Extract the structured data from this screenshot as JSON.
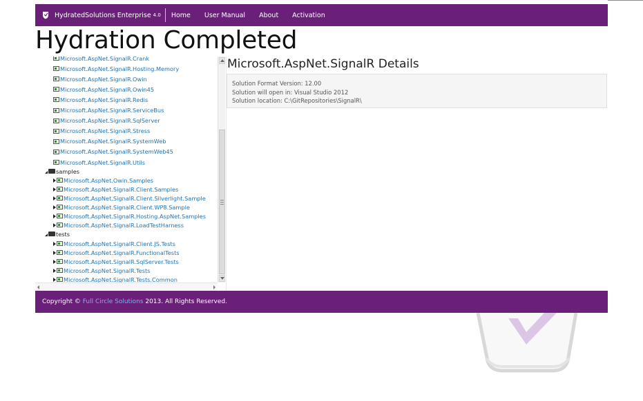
{
  "navbar": {
    "brand": "HydratedSolutions Enterprise",
    "version": "4.0",
    "items": [
      "Home",
      "User Manual",
      "About",
      "Activation"
    ]
  },
  "page_title": "Hydration Completed",
  "tree": {
    "projects_top": [
      "Microsoft.AspNet.SignalR.Crank",
      "Microsoft.AspNet.SignalR.Hosting.Memory",
      "Microsoft.AspNet.SignalR.Owin",
      "Microsoft.AspNet.SignalR.Owin45",
      "Microsoft.AspNet.SignalR.Redis",
      "Microsoft.AspNet.SignalR.ServiceBus",
      "Microsoft.AspNet.SignalR.SqlServer",
      "Microsoft.AspNet.SignalR.Stress",
      "Microsoft.AspNet.SignalR.SystemWeb",
      "Microsoft.AspNet.SignalR.SystemWeb45",
      "Microsoft.AspNet.SignalR.Utils"
    ],
    "folder_samples": "samples",
    "samples": [
      "Microsoft.AspNet.Owin.Samples",
      "Microsoft.AspNet.SignalR.Client.Samples",
      "Microsoft.AspNet.SignalR.Client.Silverlight.Sample",
      "Microsoft.AspNet.SignalR.Client.WP8.Sample",
      "Microsoft.AspNet.SignalR.Hosting.AspNet.Samples",
      "Microsoft.AspNet.SignalR.LoadTestHarness"
    ],
    "folder_tests": "tests",
    "tests": [
      "Microsoft.AspNet.SignalR.Client.JS.Tests",
      "Microsoft.AspNet.SignalR.FunctionalTests",
      "Microsoft.AspNet.SignalR.SqlServer.Tests",
      "Microsoft.AspNet.SignalR.Tests",
      "Microsoft.AspNet.SignalR.Tests.Common"
    ]
  },
  "details": {
    "title": "Microsoft.AspNet.SignalR Details",
    "lines": [
      "Solution Format Version: 12.00",
      "Solution will open in: Visual Studio 2012",
      "Solution location: C:\\GitRepositories\\SignalR\\"
    ]
  },
  "footer": {
    "prefix": "Copyright ©",
    "link": "Full Circle Solutions",
    "suffix": "2013. All Rights Reserved."
  },
  "colors": {
    "brand_purple": "#6a2079",
    "link_blue": "#1e73b5",
    "footer_link": "#7fb0f0"
  }
}
